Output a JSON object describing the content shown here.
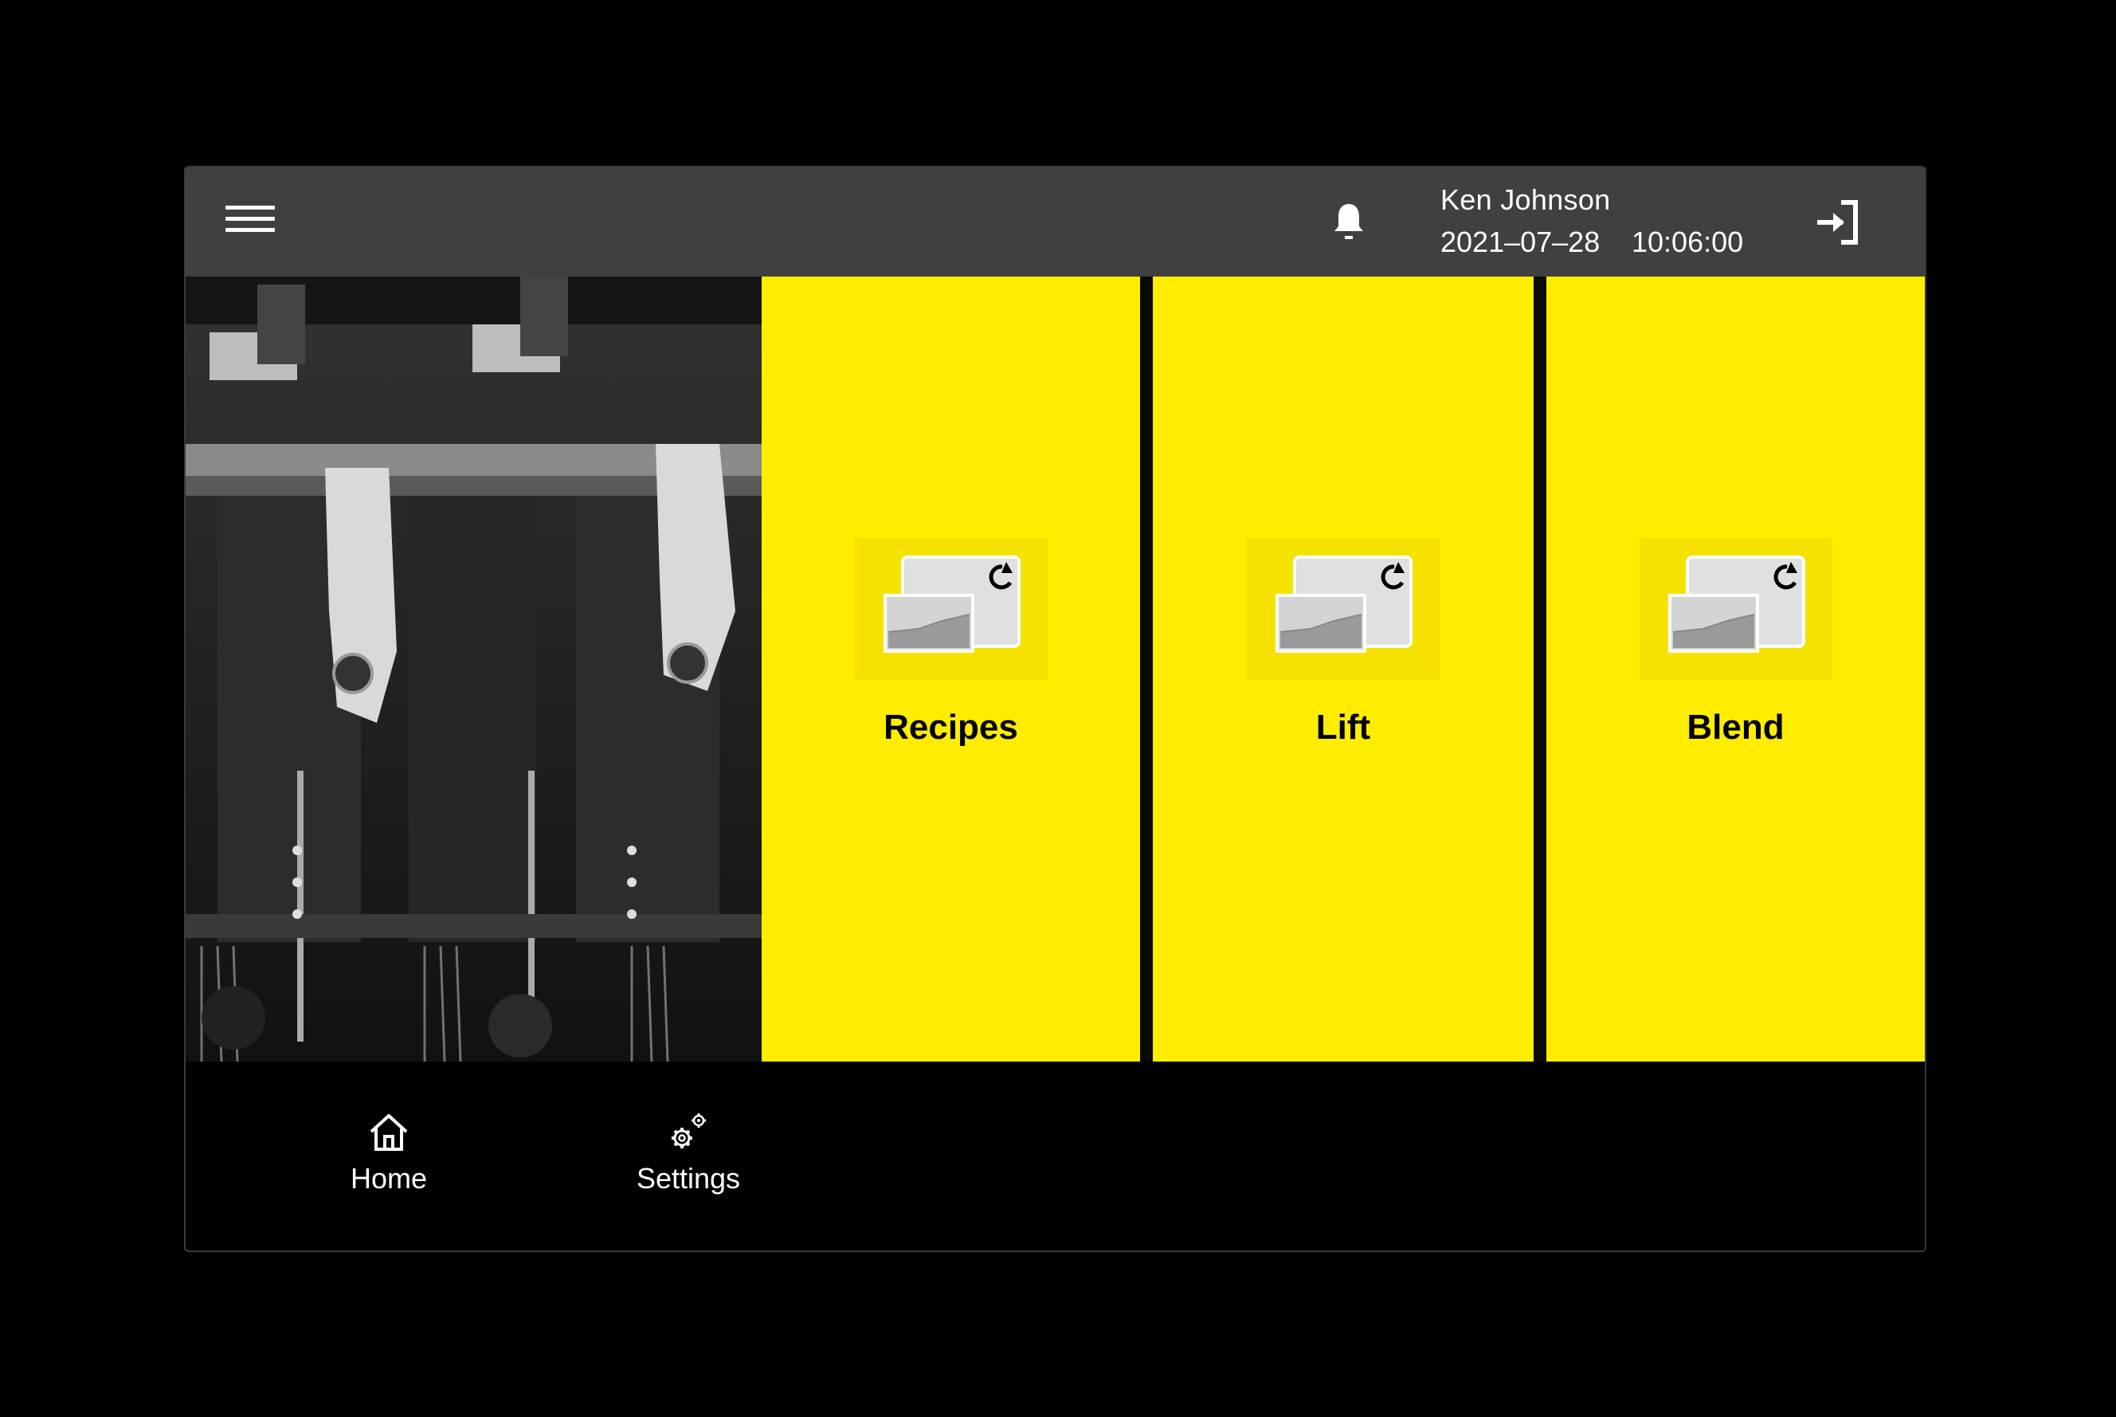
{
  "header": {
    "menu_icon": "hamburger-menu-icon",
    "notification_icon": "bell-icon",
    "user_name": "Ken Johnson",
    "date": "2021–07–28",
    "time": "10:06:00",
    "logout_icon": "sign-in-arrow-icon"
  },
  "hero_image": {
    "description_icon": "machine-photo"
  },
  "tiles": [
    {
      "label": "Recipes",
      "icon": "recipe-document-refresh-icon"
    },
    {
      "label": "Lift",
      "icon": "recipe-document-refresh-icon"
    },
    {
      "label": "Blend",
      "icon": "recipe-document-refresh-icon"
    }
  ],
  "bottom_nav": [
    {
      "label": "Home",
      "icon": "home-icon"
    },
    {
      "label": "Settings",
      "icon": "gears-icon"
    }
  ],
  "colors": {
    "accent": "#ffed00",
    "topbar": "#404040",
    "background": "#000000"
  }
}
